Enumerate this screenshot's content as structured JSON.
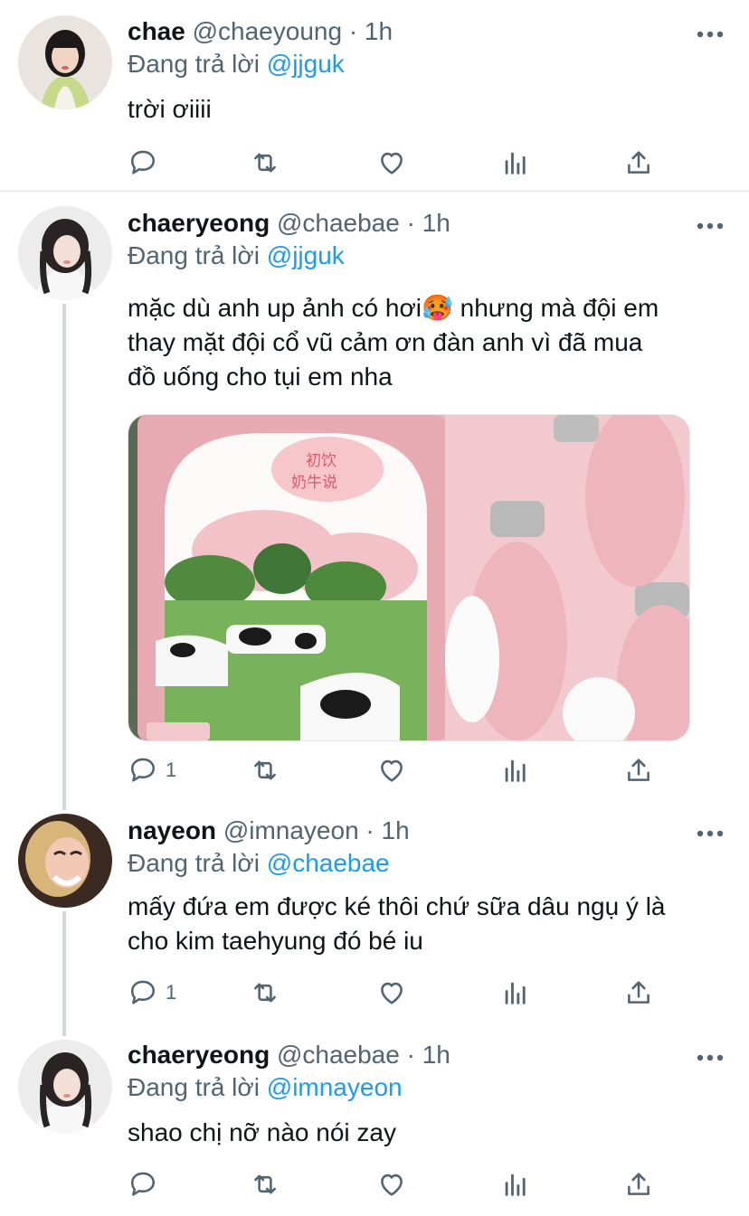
{
  "tweets": [
    {
      "name": "chae",
      "handle": "@chaeyoung · 1h",
      "replying_prefix": "Đang trả lời ",
      "replying_to": "@jjguk",
      "text": "trời ơiiii",
      "reply_count": "",
      "avatar": "avatar-chaeyoung"
    },
    {
      "name": "chaeryeong",
      "handle": "@chaebae · 1h",
      "replying_prefix": "Đang trả lời ",
      "replying_to": "@jjguk",
      "text_lines": [
        "mặc dù anh up ảnh có hơi🥵  nhưng mà đội em",
        "thay mặt đội cổ vũ cảm ơn đàn anh vì đã mua",
        "đồ uống cho tụi em nha"
      ],
      "reply_count": "1",
      "media": {
        "type": "photo",
        "description_labels": [
          "初饮",
          "奶牛说"
        ]
      },
      "avatar": "avatar-chaebae"
    },
    {
      "name": "nayeon",
      "handle": "@imnayeon · 1h",
      "replying_prefix": "Đang trả lời ",
      "replying_to": "@chaebae",
      "text_lines": [
        "mấy đứa em được ké thôi chứ sữa dâu ngụ ý là",
        "cho kim taehyung đó bé iu"
      ],
      "reply_count": "1",
      "avatar": "avatar-nayeon"
    },
    {
      "name": "chaeryeong",
      "handle": "@chaebae · 1h",
      "replying_prefix": "Đang trả lời ",
      "replying_to": "@imnayeon",
      "text": "shao chị nỡ nào nói zay",
      "reply_count": "",
      "avatar": "avatar-chaebae"
    }
  ],
  "colors": {
    "text": "#0f1419",
    "secondary": "#536471",
    "accent": "#1d9bf0",
    "divider": "#dde3e7",
    "thread_line": "#cfd9de"
  },
  "icons": [
    "reply-icon",
    "retweet-icon",
    "like-icon",
    "analytics-icon",
    "share-icon",
    "more-icon"
  ]
}
